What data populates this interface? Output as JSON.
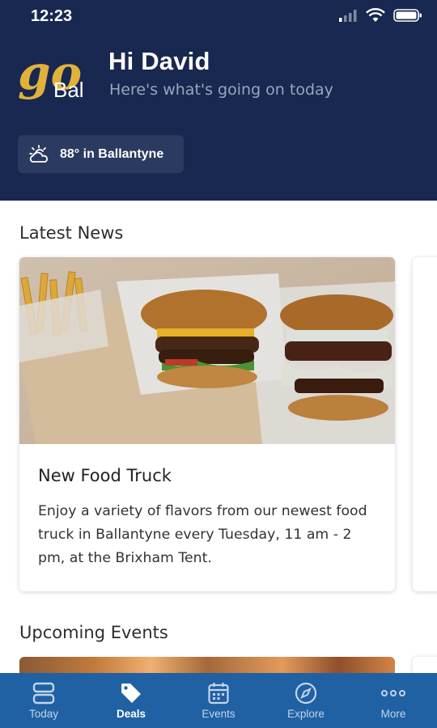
{
  "status_bar": {
    "time": "12:23"
  },
  "header": {
    "logo_text_script": "go",
    "logo_text_small": "Bal",
    "greeting": "Hi David",
    "subtitle": "Here's what's going on today",
    "weather": {
      "text": "88° in Ballantyne",
      "icon": "partly-sunny-icon"
    }
  },
  "news": {
    "section_title": "Latest News",
    "cards": [
      {
        "title": "New Food Truck",
        "body": "Enjoy a variety of flavors from our newest food truck in Ballantyne every Tuesday, 11 am - 2 pm, at the Brixham Tent."
      }
    ]
  },
  "events": {
    "section_title": "Upcoming Events"
  },
  "tabbar": {
    "active": "Deals",
    "tabs": [
      {
        "label": "Today",
        "icon": "today-stack-icon"
      },
      {
        "label": "Deals",
        "icon": "tag-icon"
      },
      {
        "label": "Events",
        "icon": "calendar-icon"
      },
      {
        "label": "Explore",
        "icon": "compass-icon"
      },
      {
        "label": "More",
        "icon": "more-dots-icon"
      }
    ]
  },
  "colors": {
    "header_bg": "#182850",
    "tabbar_bg": "#2061a4",
    "logo_gold": "#e2b13c"
  }
}
